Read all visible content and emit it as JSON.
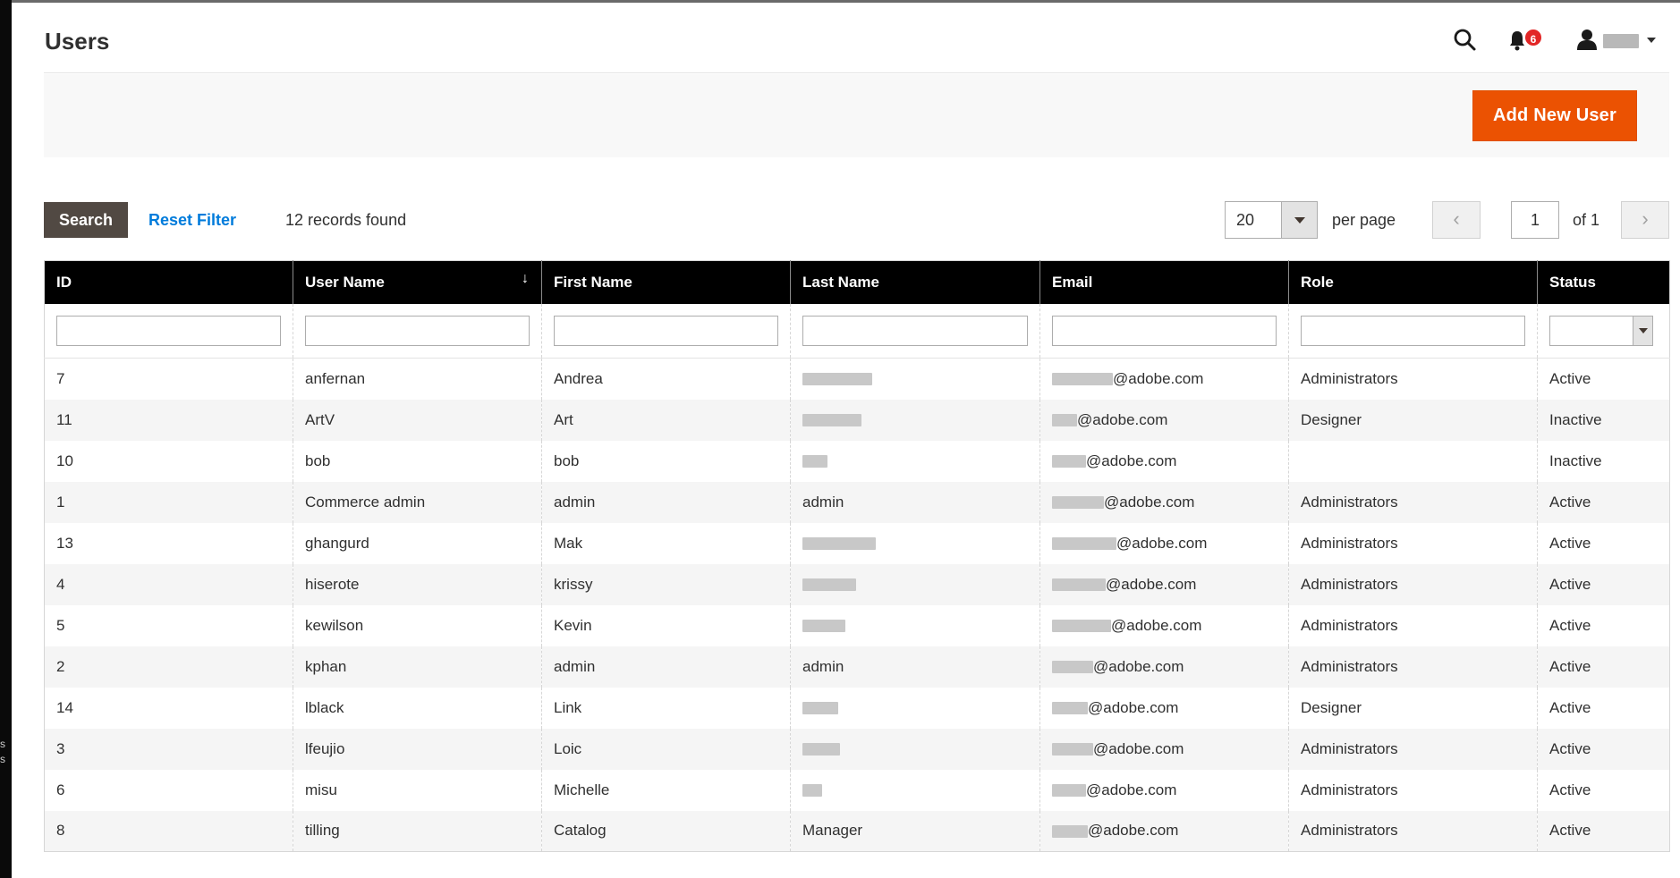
{
  "page": {
    "title": "Users",
    "notifications_count": "6",
    "left_edge_fragments": [
      "s",
      "s"
    ]
  },
  "colors": {
    "accent": "#eb5202",
    "link": "#007bdb",
    "header_bg": "#000000",
    "search_button": "#514943",
    "badge": "#e22626"
  },
  "icons": {
    "search": "search-icon",
    "notifications": "bell-icon",
    "account": "user-icon",
    "prev": "chevron-left-icon",
    "next": "chevron-right-icon"
  },
  "actions": {
    "add_new_user": "Add New User"
  },
  "toolbar": {
    "search_label": "Search",
    "reset_filter_label": "Reset Filter",
    "records_found": "12 records found",
    "per_page_value": "20",
    "per_page_label": "per page",
    "current_page": "1",
    "of_pages": "of 1"
  },
  "grid": {
    "columns": [
      "ID",
      "User Name",
      "First Name",
      "Last Name",
      "Email",
      "Role",
      "Status"
    ],
    "rows": [
      {
        "id": "7",
        "username": "anfernan",
        "first": "Andrea",
        "last": "",
        "email_suffix": "@adobe.com",
        "role": "Administrators",
        "status": "Active"
      },
      {
        "id": "11",
        "username": "ArtV",
        "first": "Art",
        "last": "",
        "email_suffix": "@adobe.com",
        "role": "Designer",
        "status": "Inactive"
      },
      {
        "id": "10",
        "username": "bob",
        "first": "bob",
        "last": "",
        "email_suffix": "@adobe.com",
        "role": "",
        "status": "Inactive"
      },
      {
        "id": "1",
        "username": "Commerce admin",
        "first": "admin",
        "last": "admin",
        "email_suffix": "@adobe.com",
        "role": "Administrators",
        "status": "Active"
      },
      {
        "id": "13",
        "username": "ghangurd",
        "first": "Mak",
        "last": "",
        "email_suffix": "@adobe.com",
        "role": "Administrators",
        "status": "Active"
      },
      {
        "id": "4",
        "username": "hiserote",
        "first": "krissy",
        "last": "",
        "email_suffix": "@adobe.com",
        "role": "Administrators",
        "status": "Active"
      },
      {
        "id": "5",
        "username": "kewilson",
        "first": "Kevin",
        "last": "",
        "email_suffix": "@adobe.com",
        "role": "Administrators",
        "status": "Active"
      },
      {
        "id": "2",
        "username": "kphan",
        "first": "admin",
        "last": "admin",
        "email_suffix": "@adobe.com",
        "role": "Administrators",
        "status": "Active"
      },
      {
        "id": "14",
        "username": "lblack",
        "first": "Link",
        "last": "",
        "email_suffix": "@adobe.com",
        "role": "Designer",
        "status": "Active"
      },
      {
        "id": "3",
        "username": "lfeujio",
        "first": "Loic",
        "last": "",
        "email_suffix": "@adobe.com",
        "role": "Administrators",
        "status": "Active"
      },
      {
        "id": "6",
        "username": "misu",
        "first": "Michelle",
        "last": "",
        "email_suffix": "@adobe.com",
        "role": "Administrators",
        "status": "Active"
      },
      {
        "id": "8",
        "username": "tilling",
        "first": "Catalog",
        "last": "Manager",
        "email_suffix": "@adobe.com",
        "role": "Administrators",
        "status": "Active"
      }
    ]
  }
}
